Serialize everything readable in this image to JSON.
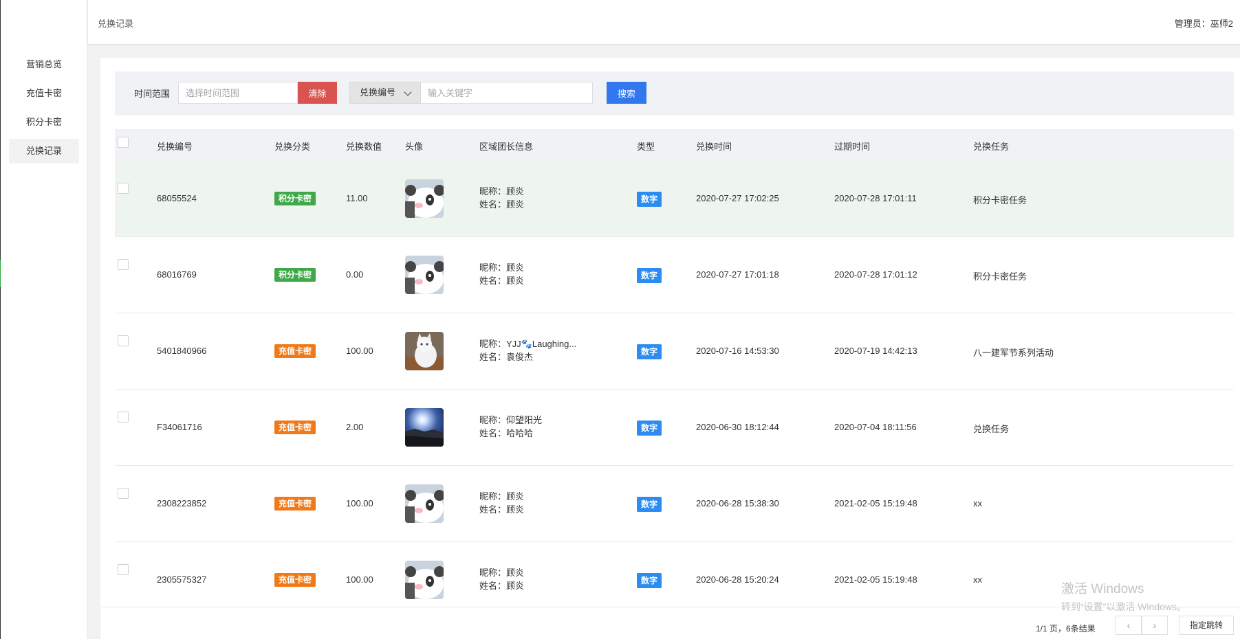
{
  "sidebar": {
    "items": [
      {
        "label": "营销总览"
      },
      {
        "label": "充值卡密"
      },
      {
        "label": "积分卡密"
      },
      {
        "label": "兑换记录"
      }
    ]
  },
  "header": {
    "breadcrumb": "兑换记录",
    "admin": "管理员：巫师2"
  },
  "filter": {
    "time_label": "时间范围",
    "time_placeholder": "选择时间范围",
    "clear_label": "清除",
    "field_select": "兑换编号",
    "keyword_placeholder": "输入关键字",
    "search_label": "搜索"
  },
  "table": {
    "columns": [
      "兑换编号",
      "兑换分类",
      "兑换数值",
      "头像",
      "区域团长信息",
      "类型",
      "兑换时间",
      "过期时间",
      "兑换任务"
    ],
    "rows": [
      {
        "id": "68055524",
        "category": "积分卡密",
        "category_color": "#3fa84a",
        "amount": "11.00",
        "avatar": "panda",
        "nickname": "昵称：顾炎",
        "name": "姓名：顾炎",
        "type": "数字",
        "redeem_time": "2020-07-27 17:02:25",
        "expire_time": "2020-07-28 17:01:11",
        "task": "积分卡密任务"
      },
      {
        "id": "68016769",
        "category": "积分卡密",
        "category_color": "#3fa84a",
        "amount": "0.00",
        "avatar": "panda",
        "nickname": "昵称：顾炎",
        "name": "姓名：顾炎",
        "type": "数字",
        "redeem_time": "2020-07-27 17:01:18",
        "expire_time": "2020-07-28 17:01:12",
        "task": "积分卡密任务"
      },
      {
        "id": "5401840966",
        "category": "充值卡密",
        "category_color": "#f07a1a",
        "amount": "100.00",
        "avatar": "cat",
        "nickname": "昵称：YJJ🐾Laughing...",
        "name": "姓名：袁俊杰",
        "type": "数字",
        "redeem_time": "2020-07-16 14:53:30",
        "expire_time": "2020-07-19 14:42:13",
        "task": "八一建军节系列活动"
      },
      {
        "id": "F34061716",
        "category": "充值卡密",
        "category_color": "#f07a1a",
        "amount": "2.00",
        "avatar": "sky",
        "nickname": "昵称：仰望阳光",
        "name": "姓名：哈哈哈",
        "type": "数字",
        "redeem_time": "2020-06-30 18:12:44",
        "expire_time": "2020-07-04 18:11:56",
        "task": "兑换任务"
      },
      {
        "id": "2308223852",
        "category": "充值卡密",
        "category_color": "#f07a1a",
        "amount": "100.00",
        "avatar": "panda",
        "nickname": "昵称：顾炎",
        "name": "姓名：顾炎",
        "type": "数字",
        "redeem_time": "2020-06-28 15:38:30",
        "expire_time": "2021-02-05 15:19:48",
        "task": "xx"
      },
      {
        "id": "2305575327",
        "category": "充值卡密",
        "category_color": "#f07a1a",
        "amount": "100.00",
        "avatar": "panda",
        "nickname": "昵称：顾炎",
        "name": "姓名：顾炎",
        "type": "数字",
        "redeem_time": "2020-06-28 15:20:24",
        "expire_time": "2021-02-05 15:19:48",
        "task": "xx"
      }
    ]
  },
  "pagination": {
    "summary": "1/1 页，6条结果",
    "prev": "‹",
    "next": "›",
    "goto_label": "指定跳转"
  },
  "watermark": {
    "line1": "激活 Windows",
    "line2": "转到“设置”以激活 Windows。"
  },
  "colors": {
    "primary_button": "#3377ee",
    "danger_button": "#d9534f",
    "type_tag": "#2d8cf0",
    "highlight_row": "#eef5ee"
  }
}
